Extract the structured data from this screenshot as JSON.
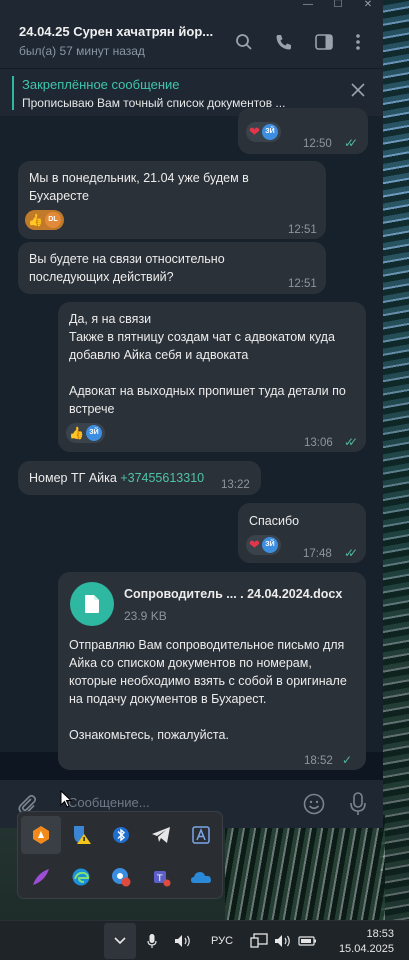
{
  "window": {
    "title": "24.04.25 Сурен хачатрян йор...",
    "status": "был(а) 57 минут назад",
    "controls": [
      "minimize",
      "maximize",
      "close"
    ]
  },
  "pinned": {
    "heading": "Закреплённое сообщение",
    "text": "Прописываю Вам точный список документов ..."
  },
  "messages": [
    {
      "dir": "out",
      "time": "12:50",
      "reactions": [
        "❤️"
      ],
      "reactor": "ЗЙ",
      "read": true
    },
    {
      "dir": "in",
      "text": "Мы в понедельник, 21.04 уже будем в Бухаресте",
      "time": "12:51",
      "reactions": [
        "👍"
      ],
      "reactor": "DL"
    },
    {
      "dir": "in",
      "text": "Вы будете на связи относительно последующих действий?",
      "time": "12:51"
    },
    {
      "dir": "out",
      "lines": [
        "Да, я на связи",
        "Также в пятницу создам чат с адвокатом куда добавлю Айка себя и адвоката",
        "",
        "Адвокат на выходных пропишет туда детали по встрече"
      ],
      "time": "13:06",
      "reactions": [
        "👍"
      ],
      "reactor": "ЗЙ",
      "read": true
    },
    {
      "dir": "in",
      "text_prefix": "Номер ТГ Айка ",
      "link": "+37455613310",
      "time": "13:22"
    },
    {
      "dir": "out",
      "text": "Спасибо",
      "time": "17:48",
      "reactions": [
        "❤️"
      ],
      "reactor": "ЗЙ",
      "read": true
    },
    {
      "dir": "out",
      "file_name": "Сопроводитель ... . 24.04.2024.docx",
      "file_size": "23.9 KB",
      "lines": [
        "Отправляю Вам сопроводительное письмо для Айка со списком документов по номерам, которые необходимо взять с собой в оригинале на подачу документов в Бухарест.",
        "",
        "Ознакомьтесь, пожалуйста."
      ],
      "time": "18:52",
      "read": false
    }
  ],
  "composer": {
    "placeholder": "Сообщение..."
  },
  "tray_icons": [
    "avast-icon",
    "defender-warning-icon",
    "bluetooth-icon",
    "telegram-icon",
    "text-app-icon",
    "feather-icon",
    "edge-icon",
    "chrome-badge-icon",
    "teams-icon",
    "onedrive-icon"
  ],
  "taskbar": {
    "language": "РУС",
    "time": "18:53",
    "date": "15.04.2025"
  },
  "colors": {
    "accent": "#2fb8a1",
    "bubble": "#2b3138",
    "chat_bg": "#17212b",
    "header": "#1e2732",
    "check": "#4fb89e"
  }
}
